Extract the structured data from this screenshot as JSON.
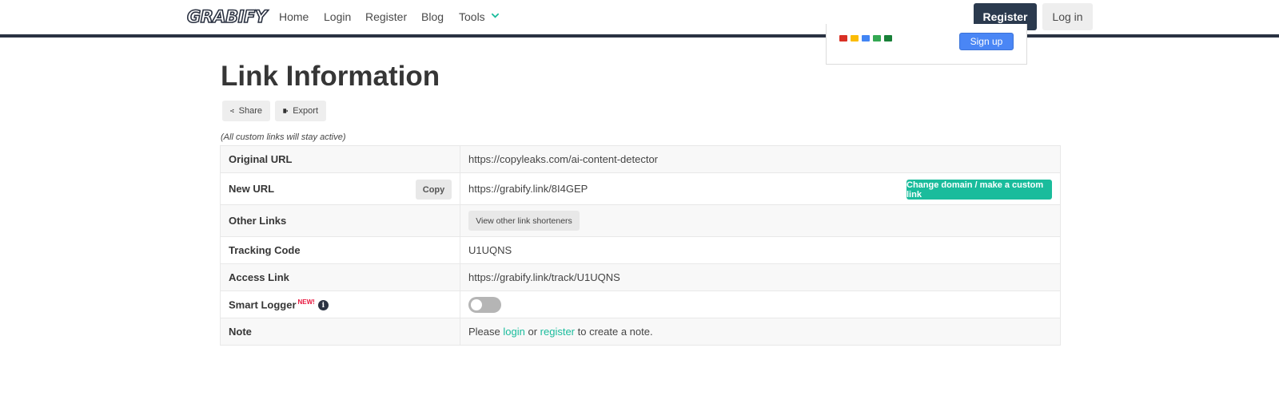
{
  "nav": {
    "logo": "GRABIFY",
    "items": [
      "Home",
      "Login",
      "Register",
      "Blog",
      "Tools"
    ],
    "register_button": "Register",
    "login_button": "Log in"
  },
  "ad": {
    "signup_label": "Sign up"
  },
  "page": {
    "title": "Link Information",
    "share_label": "Share",
    "export_label": "Export",
    "note": "(All custom links will stay active)"
  },
  "table": {
    "rows": [
      {
        "label": "Original URL",
        "value": "https://copyleaks.com/ai-content-detector"
      },
      {
        "label": "New URL",
        "value": "https://grabify.link/8I4GEP",
        "copy_label": "Copy",
        "change_label": "Change domain / make a custom link"
      },
      {
        "label": "Other Links",
        "button_label": "View other link shorteners"
      },
      {
        "label": "Tracking Code",
        "value": "U1UQNS"
      },
      {
        "label": "Access Link",
        "value": "https://grabify.link/track/U1UQNS"
      },
      {
        "label": "Smart Logger",
        "badge": "NEW!",
        "info": "i",
        "toggle_on": false
      },
      {
        "label": "Note",
        "text_pre": "Please",
        "login_link": "login",
        "text_mid": "or",
        "register_link": "register",
        "text_post": "to create a note."
      }
    ]
  },
  "colors": {
    "nav_border": "#2a3242",
    "register_bg": "#2b3a4e",
    "accent_teal": "#1abc9c",
    "badge_red": "#e8173e"
  }
}
